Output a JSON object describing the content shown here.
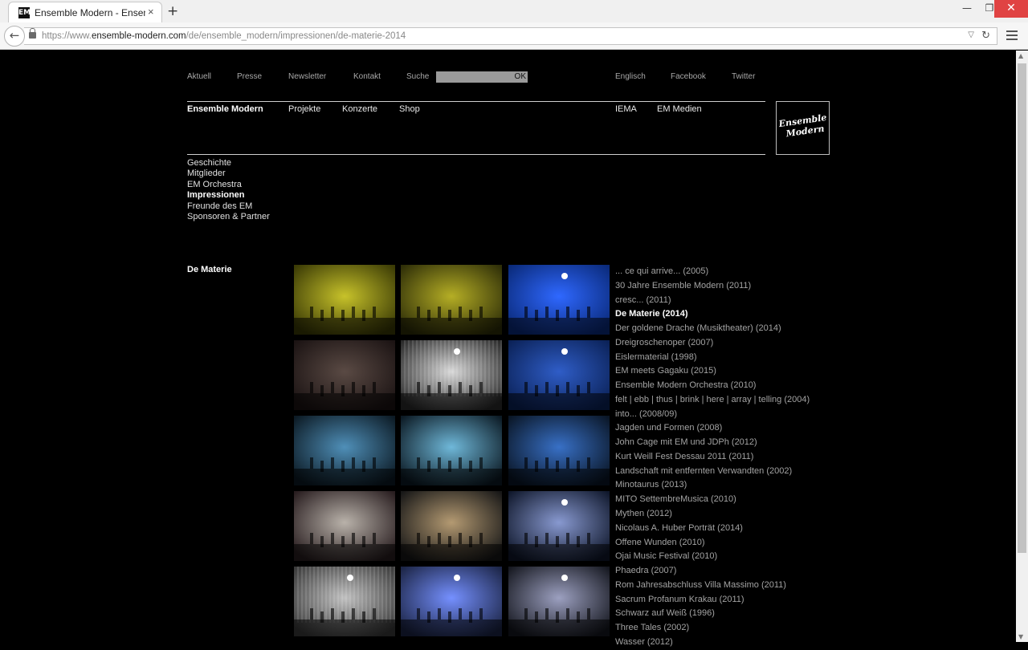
{
  "browser": {
    "tab_title": "Ensemble Modern - Ensem…",
    "tab_favicon": "EM",
    "tab_close": "×",
    "new_tab": "+",
    "url_scheme": "https://www.",
    "url_host": "ensemble-modern.com",
    "url_path": "/de/ensemble_modern/impressionen/de-materie-2014",
    "window_minimize": "—",
    "window_restore": "❐",
    "window_close": "✕"
  },
  "util_nav": {
    "aktuell": "Aktuell",
    "presse": "Presse",
    "newsletter": "Newsletter",
    "kontakt": "Kontakt",
    "suche": "Suche",
    "search_ok": "OK",
    "englisch": "Englisch",
    "facebook": "Facebook",
    "twitter": "Twitter"
  },
  "main_nav": {
    "ensemble_modern": "Ensemble Modern",
    "projekte": "Projekte",
    "konzerte": "Konzerte",
    "shop": "Shop",
    "iema": "IEMA",
    "em_medien": "EM Medien"
  },
  "logo_text": [
    "Ensemble",
    "Modern"
  ],
  "subnav": [
    {
      "label": "Geschichte",
      "active": false
    },
    {
      "label": "Mitglieder",
      "active": false
    },
    {
      "label": "EM Orchestra",
      "active": false
    },
    {
      "label": "Impressionen",
      "active": true
    },
    {
      "label": "Freunde des EM",
      "active": false
    },
    {
      "label": "Sponsoren & Partner",
      "active": false
    }
  ],
  "section_title": "De Materie",
  "gallery": [
    {
      "bg": "#3a3a05",
      "accent": "#c7c22a",
      "kind": "yellow"
    },
    {
      "bg": "#2e2e08",
      "accent": "#b5ae25",
      "kind": "yellow"
    },
    {
      "bg": "#0a2a7a",
      "accent": "#2f68ff",
      "kind": "blue"
    },
    {
      "bg": "#1b1313",
      "accent": "#5a4a44",
      "kind": "dark"
    },
    {
      "bg": "#2a2a2a",
      "accent": "#d8d8d8",
      "kind": "curtain"
    },
    {
      "bg": "#0b2258",
      "accent": "#2f5dc7",
      "kind": "blue"
    },
    {
      "bg": "#0c1a24",
      "accent": "#4f8fb8",
      "kind": "dark"
    },
    {
      "bg": "#0c1a24",
      "accent": "#6fb8d9",
      "kind": "dark"
    },
    {
      "bg": "#0a1626",
      "accent": "#3870c6",
      "kind": "dark"
    },
    {
      "bg": "#281d1f",
      "accent": "#b9b2aa",
      "kind": "dark"
    },
    {
      "bg": "#171717",
      "accent": "#b49a72",
      "kind": "dark"
    },
    {
      "bg": "#10182c",
      "accent": "#8899d0",
      "kind": "stage"
    },
    {
      "bg": "#3a3a3a",
      "accent": "#bfbfbf",
      "kind": "curtain"
    },
    {
      "bg": "#1c2546",
      "accent": "#7590ff",
      "kind": "stage"
    },
    {
      "bg": "#161820",
      "accent": "#9ca0c0",
      "kind": "stage"
    }
  ],
  "events": [
    {
      "label": "... ce qui arrive... (2005)",
      "active": false
    },
    {
      "label": "30 Jahre Ensemble Modern (2011)",
      "active": false
    },
    {
      "label": "cresc... (2011)",
      "active": false
    },
    {
      "label": "De Materie (2014)",
      "active": true
    },
    {
      "label": "Der goldene Drache (Musiktheater) (2014)",
      "active": false
    },
    {
      "label": "Dreigroschenoper (2007)",
      "active": false
    },
    {
      "label": "Eislermaterial (1998)",
      "active": false
    },
    {
      "label": "EM meets Gagaku (2015)",
      "active": false
    },
    {
      "label": "Ensemble Modern Orchestra (2010)",
      "active": false
    },
    {
      "label": "felt | ebb | thus | brink | here | array | telling (2004)",
      "active": false
    },
    {
      "label": "into... (2008/09)",
      "active": false
    },
    {
      "label": "Jagden und Formen (2008)",
      "active": false
    },
    {
      "label": "John Cage mit EM und JDPh (2012)",
      "active": false
    },
    {
      "label": "Kurt Weill Fest Dessau 2011 (2011)",
      "active": false
    },
    {
      "label": "Landschaft mit entfernten Verwandten (2002)",
      "active": false
    },
    {
      "label": "Minotaurus (2013)",
      "active": false
    },
    {
      "label": "MITO SettembreMusica (2010)",
      "active": false
    },
    {
      "label": "Mythen (2012)",
      "active": false
    },
    {
      "label": "Nicolaus A. Huber Porträt (2014)",
      "active": false
    },
    {
      "label": "Offene Wunden (2010)",
      "active": false
    },
    {
      "label": "Ojai Music Festival (2010)",
      "active": false
    },
    {
      "label": "Phaedra (2007)",
      "active": false
    },
    {
      "label": "Rom Jahresabschluss Villa Massimo (2011)",
      "active": false
    },
    {
      "label": "Sacrum Profanum Krakau (2011)",
      "active": false
    },
    {
      "label": "Schwarz auf Weiß (1996)",
      "active": false
    },
    {
      "label": "Three Tales (2002)",
      "active": false
    },
    {
      "label": "Wasser (2012)",
      "active": false
    }
  ],
  "icons": {
    "back": "arrow-left-icon",
    "lock": "lock-icon",
    "reload": "reload-icon",
    "menu": "hamburger-menu-icon"
  }
}
